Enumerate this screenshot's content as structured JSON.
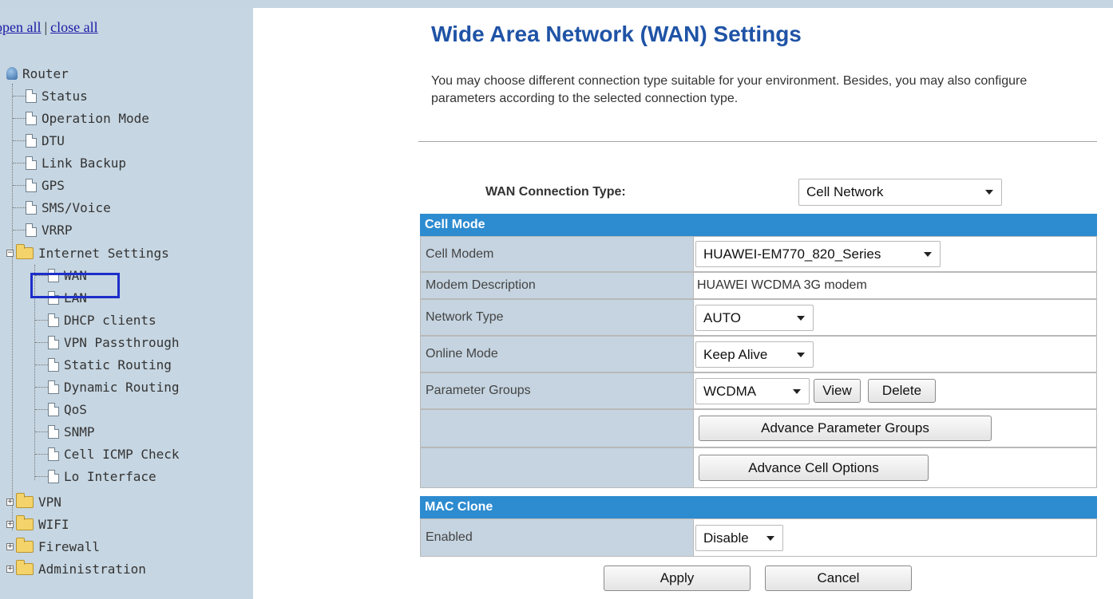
{
  "tree": {
    "open_all": "open all",
    "close_all": "close all",
    "separator": "|",
    "root": "Router",
    "items": {
      "status": "Status",
      "operation_mode": "Operation Mode",
      "dtu": "DTU",
      "link_backup": "Link Backup",
      "gps": "GPS",
      "sms_voice": "SMS/Voice",
      "vrrp": "VRRP",
      "internet_settings": "Internet Settings",
      "wan": "WAN",
      "lan": "LAN",
      "dhcp_clients": "DHCP clients",
      "vpn_passthrough": "VPN Passthrough",
      "static_routing": "Static Routing",
      "dynamic_routing": "Dynamic Routing",
      "qos": "QoS",
      "snmp": "SNMP",
      "cell_icmp_check": "Cell ICMP Check",
      "lo_interface": "Lo Interface",
      "vpn": "VPN",
      "wifi": "WIFI",
      "firewall": "Firewall",
      "administration": "Administration"
    }
  },
  "page": {
    "title": "Wide Area Network (WAN) Settings",
    "intro": "You may choose different connection type suitable for your environment. Besides, you may also configure parameters according to the selected connection type.",
    "wan_type_label": "WAN Connection Type:",
    "wan_type_value": "Cell Network"
  },
  "cell_mode": {
    "header": "Cell Mode",
    "cell_modem_label": "Cell Modem",
    "cell_modem_value": "HUAWEI-EM770_820_Series",
    "modem_description_label": "Modem Description",
    "modem_description_value": "HUAWEI WCDMA 3G modem",
    "network_type_label": "Network Type",
    "network_type_value": "AUTO",
    "online_mode_label": "Online Mode",
    "online_mode_value": "Keep Alive",
    "parameter_groups_label": "Parameter Groups",
    "parameter_groups_value": "WCDMA",
    "view_label": "View",
    "delete_label": "Delete",
    "advance_param_groups_label": "Advance Parameter Groups",
    "advance_cell_options_label": "Advance Cell Options"
  },
  "mac_clone": {
    "header": "MAC Clone",
    "enabled_label": "Enabled",
    "enabled_value": "Disable"
  },
  "actions": {
    "apply": "Apply",
    "cancel": "Cancel"
  },
  "colors": {
    "sidebar_bg": "#c6d6e2",
    "section_header": "#2d8bd0",
    "title": "#1f53a6",
    "highlight_box": "#1c2ec9"
  }
}
